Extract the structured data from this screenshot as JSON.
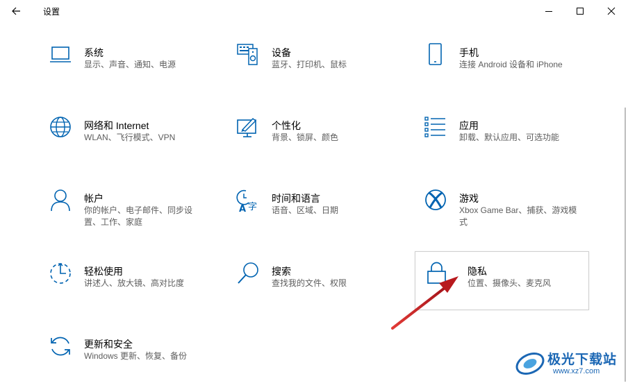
{
  "window": {
    "title": "设置",
    "controls": [
      "minimize-icon",
      "maximize-icon",
      "close-icon"
    ]
  },
  "tiles": [
    {
      "name": "系统",
      "desc": "显示、声音、通知、电源",
      "icon": "laptop-icon"
    },
    {
      "name": "设备",
      "desc": "蓝牙、打印机、鼠标",
      "icon": "keyboard-speaker-icon"
    },
    {
      "name": "手机",
      "desc": "连接 Android 设备和 iPhone",
      "icon": "phone-icon"
    },
    {
      "name": "网络和 Internet",
      "desc": "WLAN、飞行模式、VPN",
      "icon": "globe-icon"
    },
    {
      "name": "个性化",
      "desc": "背景、锁屏、颜色",
      "icon": "paint-monitor-icon"
    },
    {
      "name": "应用",
      "desc": "卸载、默认应用、可选功能",
      "icon": "apps-list-icon"
    },
    {
      "name": "帐户",
      "desc": "你的帐户、电子邮件、同步设置、工作、家庭",
      "icon": "person-icon"
    },
    {
      "name": "时间和语言",
      "desc": "语音、区域、日期",
      "icon": "time-language-icon"
    },
    {
      "name": "游戏",
      "desc": "Xbox Game Bar、捕获、游戏模式",
      "icon": "xbox-icon"
    },
    {
      "name": "轻松使用",
      "desc": "讲述人、放大镜、高对比度",
      "icon": "ease-of-access-icon"
    },
    {
      "name": "搜索",
      "desc": "查找我的文件、权限",
      "icon": "search-icon"
    },
    {
      "name": "隐私",
      "desc": "位置、摄像头、麦克风",
      "icon": "lock-icon"
    },
    {
      "name": "更新和安全",
      "desc": "Windows 更新、恢复、备份",
      "icon": "sync-icon"
    }
  ],
  "accent": "#0063b1",
  "annotation_arrow_color": "#c8201e",
  "watermark": {
    "title": "极光下载站",
    "url": "www.xz7.com"
  }
}
